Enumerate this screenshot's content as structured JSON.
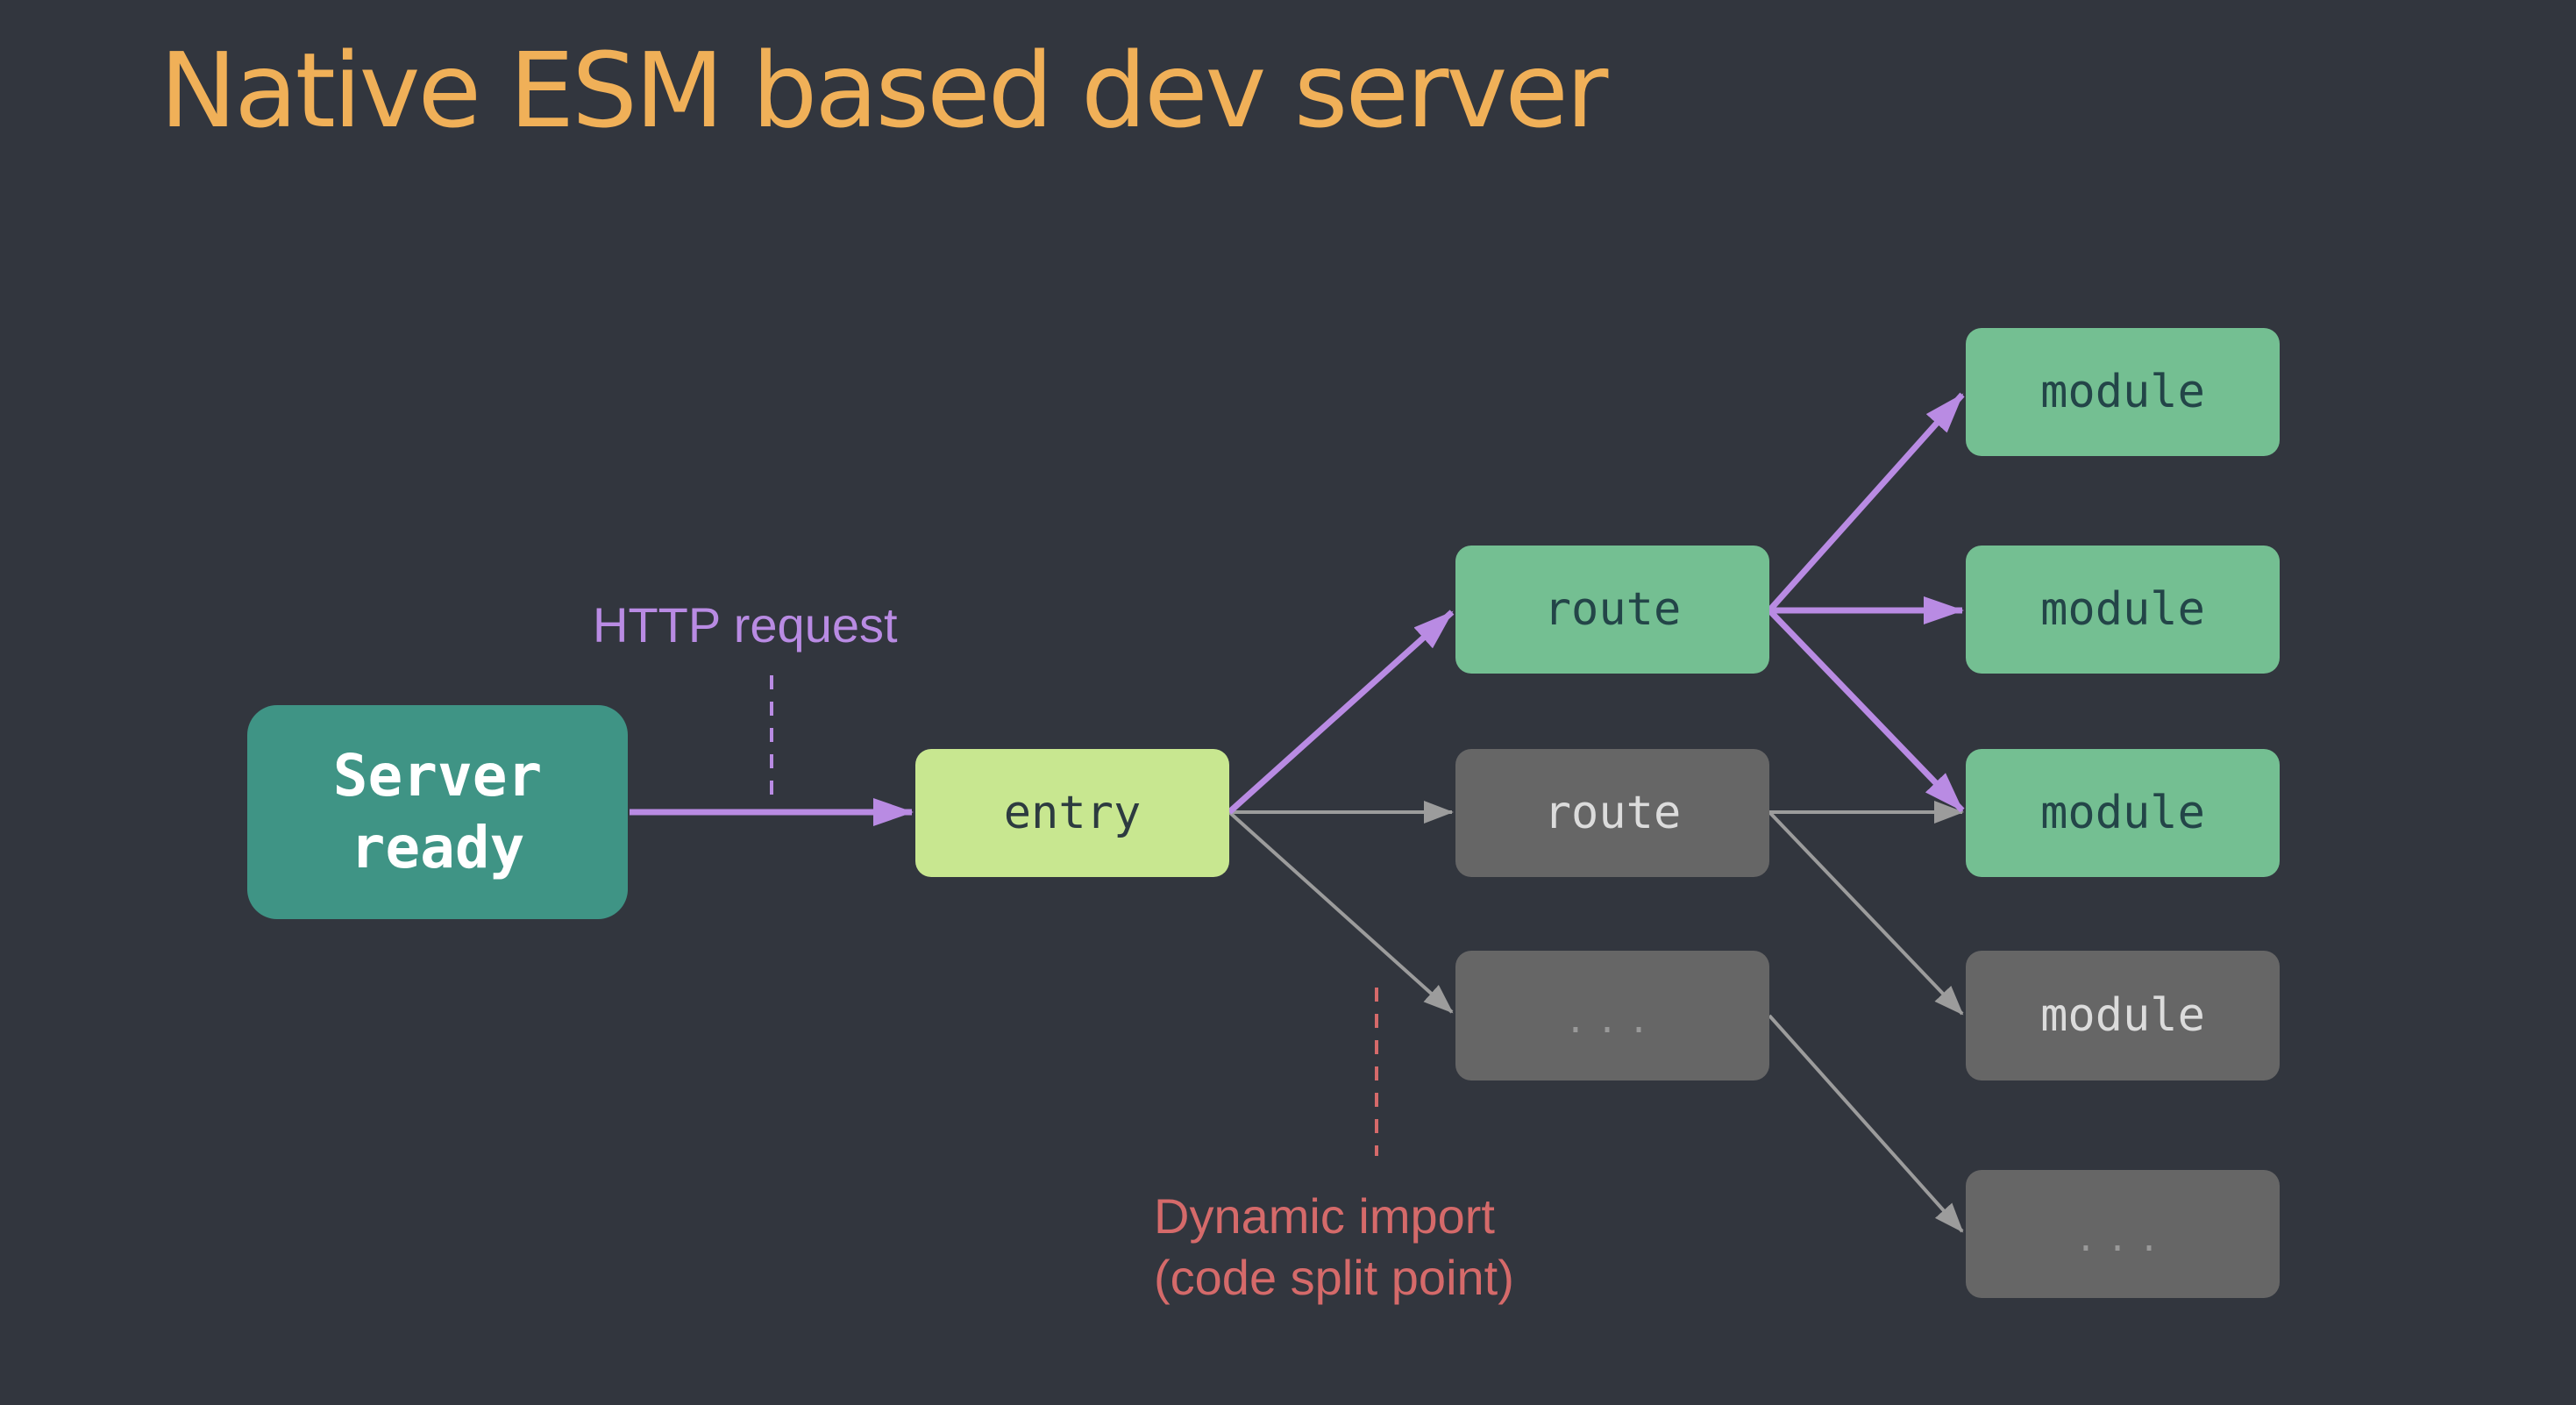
{
  "title": "Native ESM based dev server",
  "labels": {
    "http_request": "HTTP request",
    "dynamic_import_line1": "Dynamic import",
    "dynamic_import_line2": "(code split point)"
  },
  "nodes": {
    "server": "Server\nready",
    "entry": "entry",
    "route_active": "route",
    "route_inactive": "route",
    "route_ellipsis": "...",
    "module_1": "module",
    "module_2": "module",
    "module_3": "module",
    "module_4": "module",
    "module_ellipsis": "..."
  },
  "colors": {
    "background": "#32363e",
    "title": "#f0b058",
    "server_fill": "#3f9485",
    "server_text": "#ffffff",
    "entry_fill": "#c8e790",
    "entry_text": "#2d3b40",
    "active_fill": "#74bf92",
    "active_text": "#234548",
    "inactive_fill": "#666666",
    "inactive_text": "#dcdcdc",
    "ellipsis_text": "#999999",
    "active_arrow": "#b98be3",
    "inactive_arrow": "#9c9c9c",
    "http_label": "#b98be3",
    "dynamic_label": "#d56a6a"
  }
}
